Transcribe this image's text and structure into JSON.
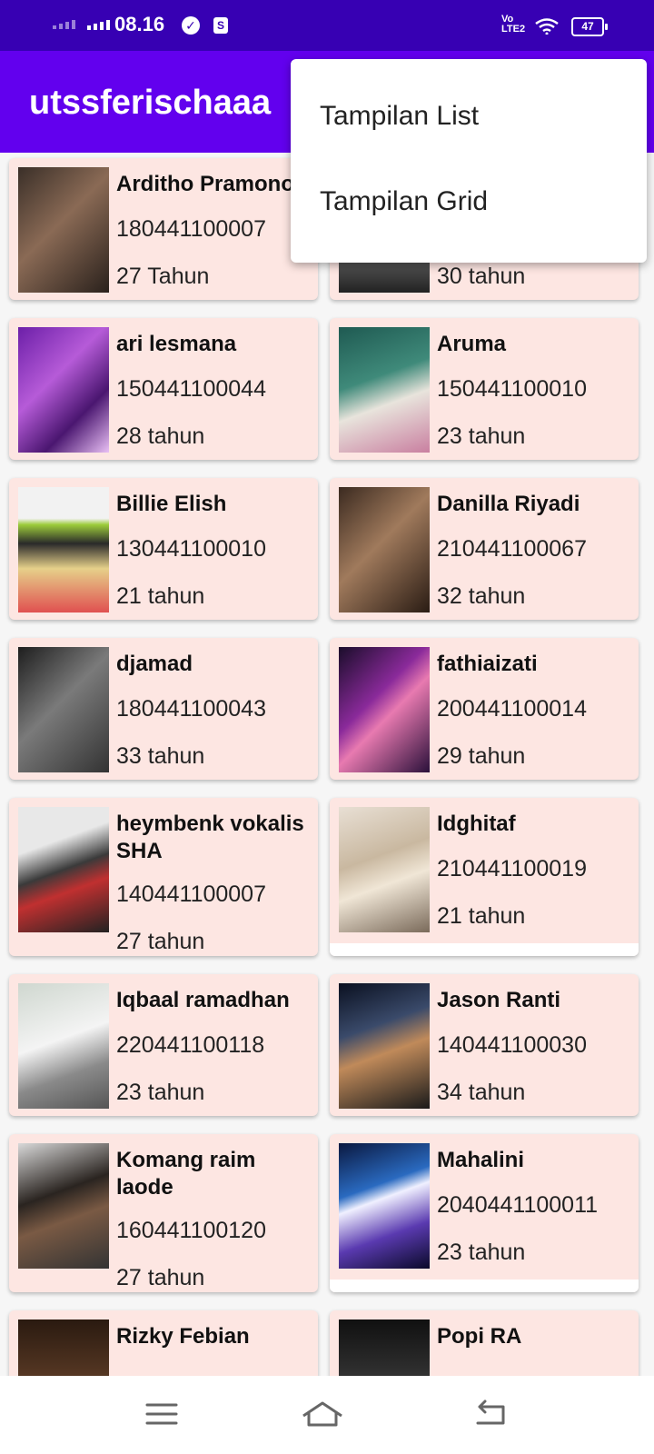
{
  "status_bar": {
    "time": "08.16",
    "network_label": "LTE2",
    "battery": "47"
  },
  "app_bar": {
    "title": "utssferischaaa"
  },
  "menu": {
    "items": [
      "Tampilan List",
      "Tampilan Grid"
    ]
  },
  "cards": [
    {
      "name": "Arditho Pramono",
      "nim": "180441100007",
      "age": "27 Tahun",
      "photo": "person-with-glasses-photo"
    },
    {
      "name": "",
      "nim": "",
      "age": "30 tahun",
      "photo": "person-photo"
    },
    {
      "name": "ari lesmana",
      "nim": "150441100044",
      "age": "28 tahun",
      "photo": "singer-on-stage-photo"
    },
    {
      "name": "Aruma",
      "nim": "150441100010",
      "age": "23 tahun",
      "photo": "woman-with-flowers-photo"
    },
    {
      "name": "Billie Elish",
      "nim": "130441100010",
      "age": "21 tahun",
      "photo": "green-hair-photo"
    },
    {
      "name": "Danilla Riyadi",
      "nim": "210441100067",
      "age": "32 tahun",
      "photo": "woman-with-guitar-photo"
    },
    {
      "name": "djamad",
      "nim": "180441100043",
      "age": "33 tahun",
      "photo": "guitarist-bw-photo"
    },
    {
      "name": "fathiaizati",
      "nim": "200441100014",
      "age": "29 tahun",
      "photo": "singer-purple-light-photo"
    },
    {
      "name": "heymbenk vokalis SHA",
      "nim": "140441100007",
      "age": "27 tahun",
      "photo": "bassist-cap-photo"
    },
    {
      "name": "Idghitaf",
      "nim": "210441100019",
      "age": "21 tahun",
      "photo": "smiling-woman-photo"
    },
    {
      "name": "Iqbaal ramadhan",
      "nim": "220441100118",
      "age": "23 tahun",
      "photo": "man-with-guitar-photo"
    },
    {
      "name": "Jason Ranti",
      "nim": "140441100030",
      "age": "34 tahun",
      "photo": "acoustic-performer-photo"
    },
    {
      "name": "Komang raim laode",
      "nim": "160441100120",
      "age": "27 tahun",
      "photo": "curly-hair-singer-photo"
    },
    {
      "name": "Mahalini",
      "nim": "2040441100011",
      "age": "23 tahun",
      "photo": "concert-stage-photo"
    },
    {
      "name": "Rizky Febian",
      "nim": "",
      "age": "",
      "photo": "partial-photo"
    },
    {
      "name": "Popi RA",
      "nim": "",
      "age": "",
      "photo": "partial-photo"
    }
  ],
  "colors": {
    "status_bar": "#3700b3",
    "app_bar": "#6200ee",
    "card_bg": "#fde6e2"
  }
}
